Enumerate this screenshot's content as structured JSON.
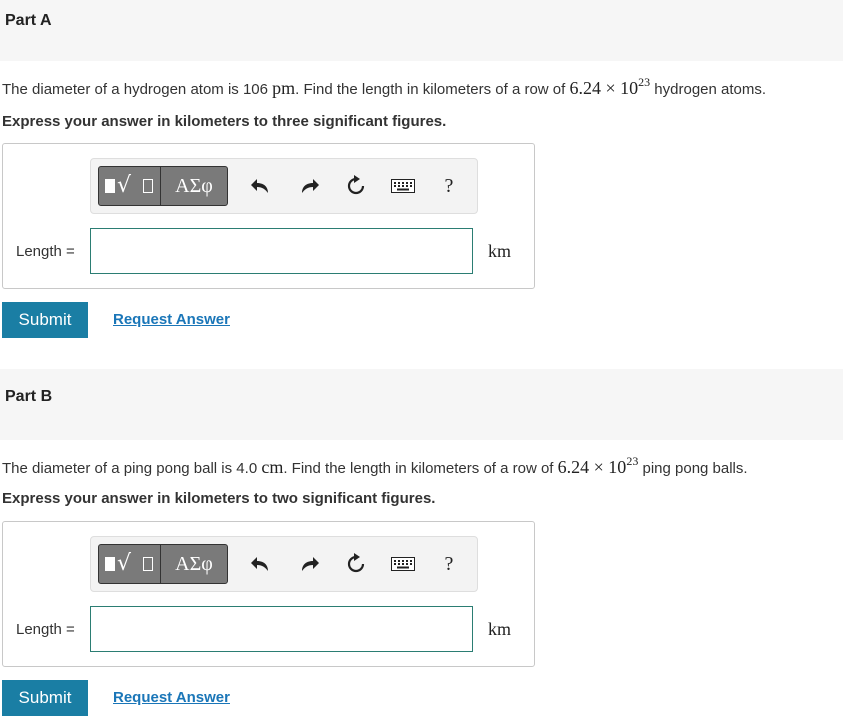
{
  "parts": [
    {
      "title": "Part A",
      "question": {
        "pre": "The diameter of a hydrogen atom is 106 ",
        "unit1": "pm",
        "mid": ". Find the length in kilometers of a row of ",
        "math_base": "6.24 × 10",
        "math_exp": "23",
        "post": " hydrogen atoms."
      },
      "instruction": "Express your answer in kilometers to three significant figures.",
      "toolbar": {
        "symbols_label": "ΑΣφ",
        "help_label": "?"
      },
      "answer_label": "Length =",
      "answer_value": "",
      "unit": "km",
      "submit_label": "Submit",
      "request_label": "Request Answer"
    },
    {
      "title": "Part B",
      "question": {
        "pre": "The diameter of a ping pong ball is 4.0 ",
        "unit1": "cm",
        "mid": ". Find the length in kilometers of a row of ",
        "math_base": "6.24 × 10",
        "math_exp": "23",
        "post": " ping pong balls."
      },
      "instruction": "Express your answer in kilometers to two significant figures.",
      "toolbar": {
        "symbols_label": "ΑΣφ",
        "help_label": "?"
      },
      "answer_label": "Length =",
      "answer_value": "",
      "unit": "km",
      "submit_label": "Submit",
      "request_label": "Request Answer"
    }
  ]
}
